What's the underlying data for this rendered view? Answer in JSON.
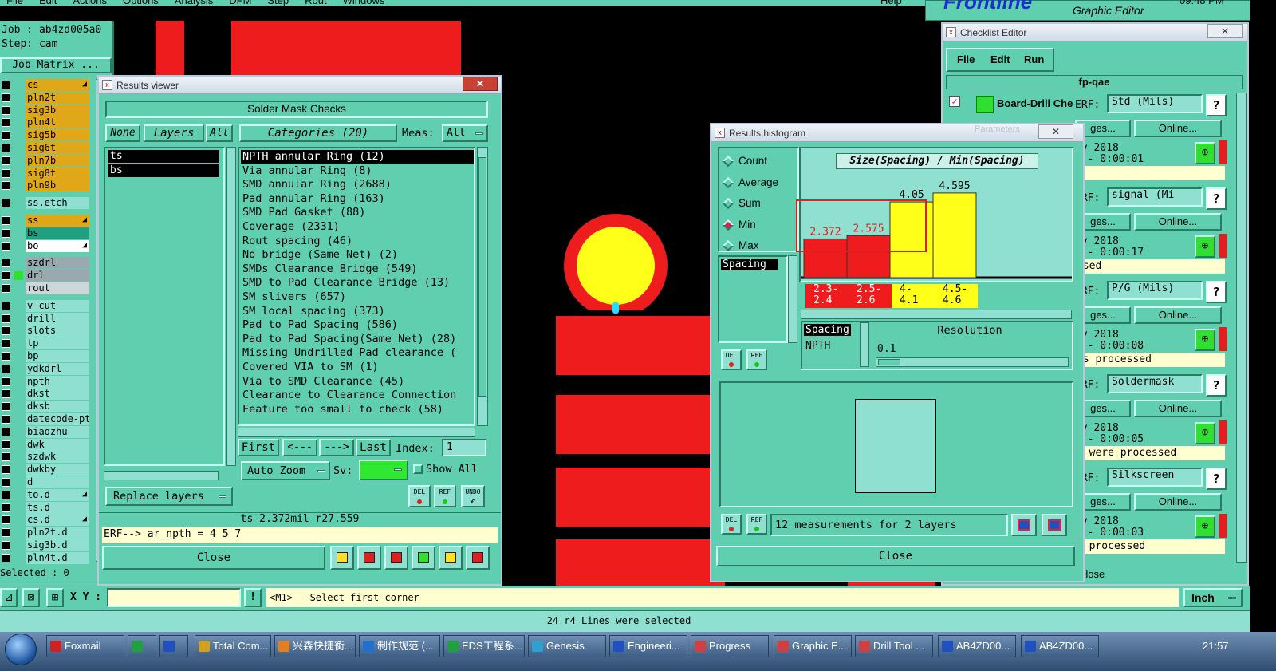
{
  "menubar": {
    "items": [
      "File",
      "Edit",
      "Actions",
      "Options",
      "Analysis",
      "DFM",
      "Step",
      "Rout",
      "Windows"
    ],
    "help": "Help",
    "brand": "Frontline",
    "subtitle": "Graphic Editor",
    "clock": "09:48 PM"
  },
  "left_panel": {
    "job": "Job : ab4zd005a0",
    "step": "Step: cam",
    "job_matrix": "Job Matrix ...",
    "selected": "Selected : 0",
    "layers": [
      {
        "name": "cs",
        "color": "#e0a818",
        "arrow": true
      },
      {
        "name": "pln2t",
        "color": "#e0a818"
      },
      {
        "name": "sig3b",
        "color": "#e0a818"
      },
      {
        "name": "pln4t",
        "color": "#e0a818"
      },
      {
        "name": "sig5b",
        "color": "#e0a818"
      },
      {
        "name": "sig6t",
        "color": "#e0a818"
      },
      {
        "name": "pln7b",
        "color": "#e0a818"
      },
      {
        "name": "sig8t",
        "color": "#e0a818"
      },
      {
        "name": "pln9b",
        "color": "#e0a818"
      },
      {
        "name": "ss.etch",
        "color": "#8fe0d0",
        "gap": true
      },
      {
        "name": "ss",
        "color": "#e0a818",
        "arrow": true,
        "gap": true
      },
      {
        "name": "bs",
        "color": "#20a080"
      },
      {
        "name": "bo",
        "color": "#ffffff",
        "arrow": true
      },
      {
        "name": "szdrl",
        "color": "#9aa8b0",
        "gap": true
      },
      {
        "name": "drl",
        "color": "#9aa8b0",
        "mark": "#30e030"
      },
      {
        "name": "rout",
        "color": "#cfd6da"
      },
      {
        "name": "v-cut",
        "color": "#8fe0d0",
        "gap": true
      },
      {
        "name": "drill",
        "color": "#8fe0d0"
      },
      {
        "name": "slots",
        "color": "#8fe0d0"
      },
      {
        "name": "tp",
        "color": "#8fe0d0"
      },
      {
        "name": "bp",
        "color": "#8fe0d0"
      },
      {
        "name": "ydkdrl",
        "color": "#8fe0d0"
      },
      {
        "name": "npth",
        "color": "#8fe0d0"
      },
      {
        "name": "dkst",
        "color": "#8fe0d0"
      },
      {
        "name": "dksb",
        "color": "#8fe0d0"
      },
      {
        "name": "datecode-ptd",
        "color": "#8fe0d0"
      },
      {
        "name": "biaozhu",
        "color": "#8fe0d0"
      },
      {
        "name": "dwk",
        "color": "#8fe0d0"
      },
      {
        "name": "szdwk",
        "color": "#8fe0d0"
      },
      {
        "name": "dwkby",
        "color": "#8fe0d0"
      },
      {
        "name": "d",
        "color": "#8fe0d0"
      },
      {
        "name": "to.d",
        "color": "#8fe0d0",
        "arrow": true
      },
      {
        "name": "ts.d",
        "color": "#8fe0d0"
      },
      {
        "name": "cs.d",
        "color": "#8fe0d0",
        "arrow": true
      },
      {
        "name": "pln2t.d",
        "color": "#8fe0d0"
      },
      {
        "name": "sig3b.d",
        "color": "#8fe0d0"
      },
      {
        "name": "pln4t.d",
        "color": "#8fe0d0"
      }
    ]
  },
  "results_viewer": {
    "title": "Results viewer",
    "heading": "Solder Mask Checks",
    "none_btn": "None",
    "layers_btn": "Layers",
    "all_btn": "All",
    "categories_label": "Categories (20)",
    "meas_label": "Meas:",
    "meas_value": "All",
    "layer_list": [
      "ts",
      "bs"
    ],
    "categories": [
      "NPTH annular Ring (12)",
      "Via annular Ring (8)",
      "SMD annular Ring (2688)",
      "Pad annular Ring (163)",
      "SMD Pad Gasket (88)",
      "Coverage (2331)",
      "Rout spacing (46)",
      "No bridge (Same Net) (2)",
      "SMDs Clearance Bridge (549)",
      "SMD to Pad Clearance Bridge (13)",
      "SM slivers (657)",
      "SM local spacing (373)",
      "Pad to Pad Spacing (586)",
      "Pad to Pad Spacing(Same Net) (28)",
      "Missing Undrilled Pad clearance (",
      "Covered VIA to SM (1)",
      "Via to SMD Clearance (45)",
      "Clearance to Clearance Connection",
      "Feature too small to check (58)"
    ],
    "first_btn": "First",
    "prev_btn": "<---",
    "next_btn": "--->",
    "last_btn": "Last",
    "index_label": "Index:",
    "index_value": "1",
    "auto_zoom": "Auto Zoom",
    "sv_label": "Sv:",
    "show_all": "Show All",
    "replace_layers": "Replace layers",
    "status": "ts 2.372mil  r27.559",
    "erf_line": "ERF--> ar_npth = 4 5 7",
    "close": "Close",
    "del": "DEL",
    "ref": "REF",
    "undo": "UNDO"
  },
  "histogram": {
    "title": "Results histogram",
    "options": [
      "Count",
      "Average",
      "Sum",
      "Min",
      "Max"
    ],
    "selected_option": "Min",
    "measure_list": [
      "Spacing"
    ],
    "chart_title": "Size(Spacing) / Min(Spacing)",
    "resolution_label": "Resolution",
    "resolution_value": "0.1",
    "spacing_label": "Spacing",
    "npth_label": "NPTH",
    "measurements": "12 measurements for 2 layers",
    "close": "Close",
    "del": "DEL",
    "ref": "REF"
  },
  "chart_data": {
    "type": "bar",
    "title": "Size(Spacing) / Min(Spacing)",
    "categories": [
      "2.3-2.4",
      "2.5-2.6",
      "4-4.1",
      "4.5-4.6"
    ],
    "category_lines": [
      [
        "2.3-",
        "2.4"
      ],
      [
        "2.5-",
        "2.6"
      ],
      [
        "4-",
        "4.1"
      ],
      [
        "4.5-",
        "4.6"
      ]
    ],
    "values": [
      2.372,
      2.575,
      4.05,
      4.595
    ],
    "value_labels": [
      "2.372",
      "2.575",
      "4.05",
      "4.595"
    ],
    "colors": [
      "#ee1c1c",
      "#ee1c1c",
      "#ffff1a",
      "#ffff1a"
    ],
    "label_colors": [
      "#ee1c1c",
      "#ee1c1c",
      "#000000",
      "#000000"
    ],
    "ylim": [
      0,
      5
    ]
  },
  "checklist": {
    "title": "Checklist Editor",
    "menu": [
      "File",
      "Edit",
      "Run"
    ],
    "name": "fp-qae",
    "first_row": "Board-Drill Che",
    "rows": [
      {
        "erf": "Std (Mils)",
        "date": "ov 2018",
        "time": "I - 0:00:01",
        "status": ""
      },
      {
        "erf": "signal (Mi",
        "date": "ov 2018",
        "time": "I - 0:00:17",
        "status": "ssed"
      },
      {
        "erf": "P/G (Mils)",
        "date": "ov 2018",
        "time": "I - 0:00:08",
        "status": "rs processed"
      },
      {
        "erf": "Soldermask",
        "date": "ov 2018",
        "time": "I - 0:00:05",
        "status": "s were processed"
      },
      {
        "erf": "Silkscreen",
        "date": "ov 2018",
        "time": "I - 0:00:03",
        "status": "s processed"
      }
    ],
    "erf_label": "ERF:",
    "ges_label": "ges...",
    "online_label": "Online...",
    "help": "?",
    "close": "Close",
    "hidden_tab": "Parameters"
  },
  "bottom": {
    "xy_label": "X Y :",
    "prompt": "<M1> - Select first corner",
    "units": "Inch",
    "message": "24 r4 Lines were selected"
  },
  "taskbar": {
    "items": [
      "Foxmail",
      "",
      "",
      "Total Com...",
      "兴森快捷衡...",
      "制作规范 (...",
      "EDS工程系...",
      "Genesis",
      "Engineeri...",
      "Progress",
      "Graphic E...",
      "Drill Tool ...",
      "AB4ZD00...",
      "AB4ZD00..."
    ],
    "clock": "21:57"
  }
}
